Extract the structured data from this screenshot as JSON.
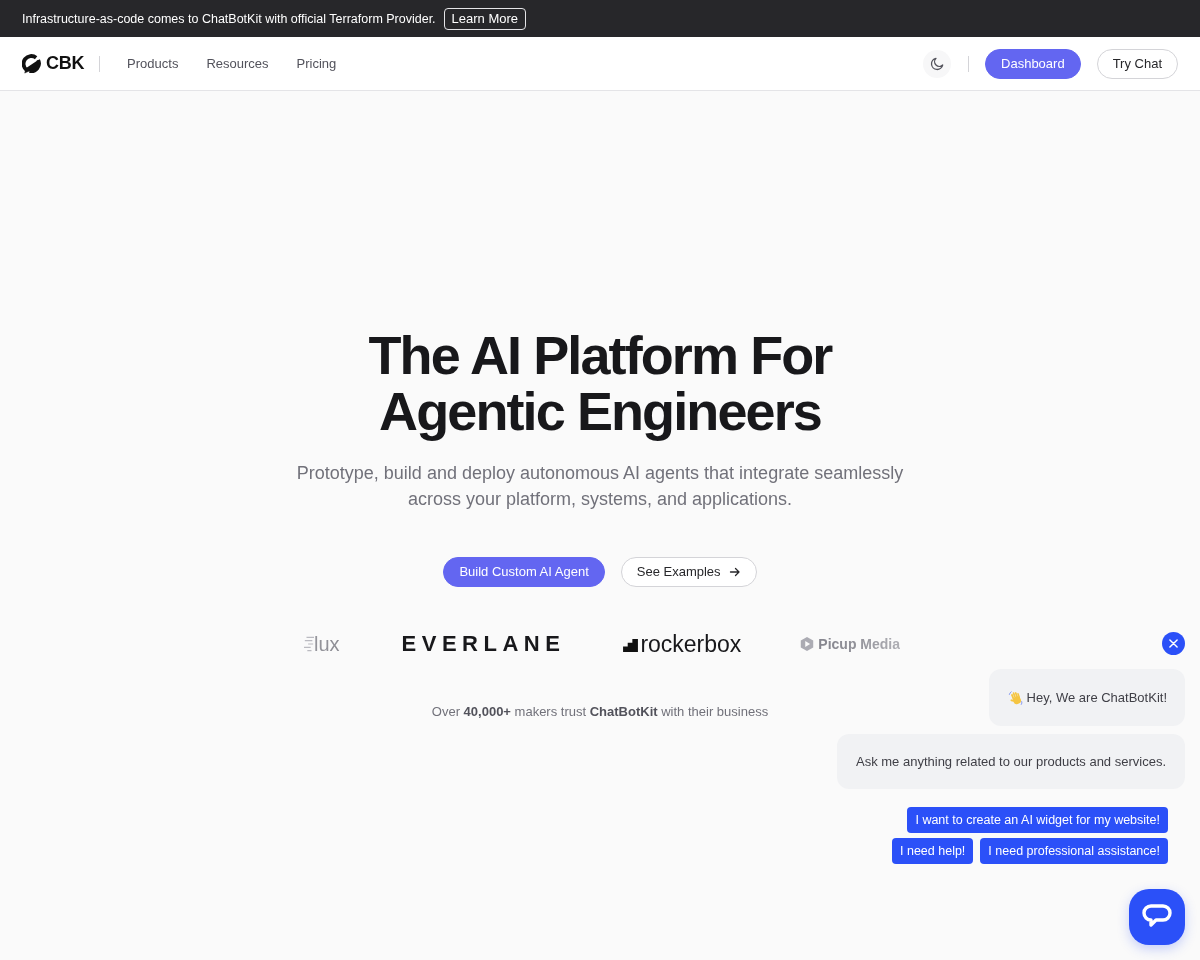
{
  "announcement": {
    "text": "Infrastructure-as-code comes to ChatBotKit with official Terraform Provider.",
    "link": "Learn More"
  },
  "nav": {
    "logo": "CBK",
    "links": [
      "Products",
      "Resources",
      "Pricing"
    ],
    "buttons": [
      {
        "label": "Dashboard",
        "kind": "primary"
      },
      {
        "label": "Try Chat",
        "kind": "outline"
      }
    ]
  },
  "hero": {
    "title": "The AI Platform For Agentic Engineers",
    "subtitle": "Prototype, build and deploy autonomous AI agents that integrate seamlessly across your platform, systems, and applications.",
    "buttons": [
      {
        "label": "Build Custom AI Agent",
        "kind": "primary"
      },
      {
        "label": "See Examples",
        "kind": "secondary"
      }
    ],
    "logos": [
      {
        "name": "lux",
        "kind": "lines"
      },
      {
        "name": "EVERLANE",
        "kind": "spaced"
      },
      {
        "name": "rockerbox",
        "kind": "stairs"
      },
      {
        "name": "Picup Media",
        "kind": "play"
      }
    ],
    "trust": "Over **40,000+** makers trust **ChatBotKit** with their business"
  },
  "chat_widget": {
    "messages": [
      {
        "text": "Hey, We are ChatBotKit!",
        "kind": "greeting"
      },
      {
        "text": "Ask me anything related to our products and services.",
        "kind": "plain"
      }
    ],
    "quick_replies": [
      "I want to create an AI widget for my website!",
      "I need help!",
      "I need professional assistance!"
    ]
  }
}
